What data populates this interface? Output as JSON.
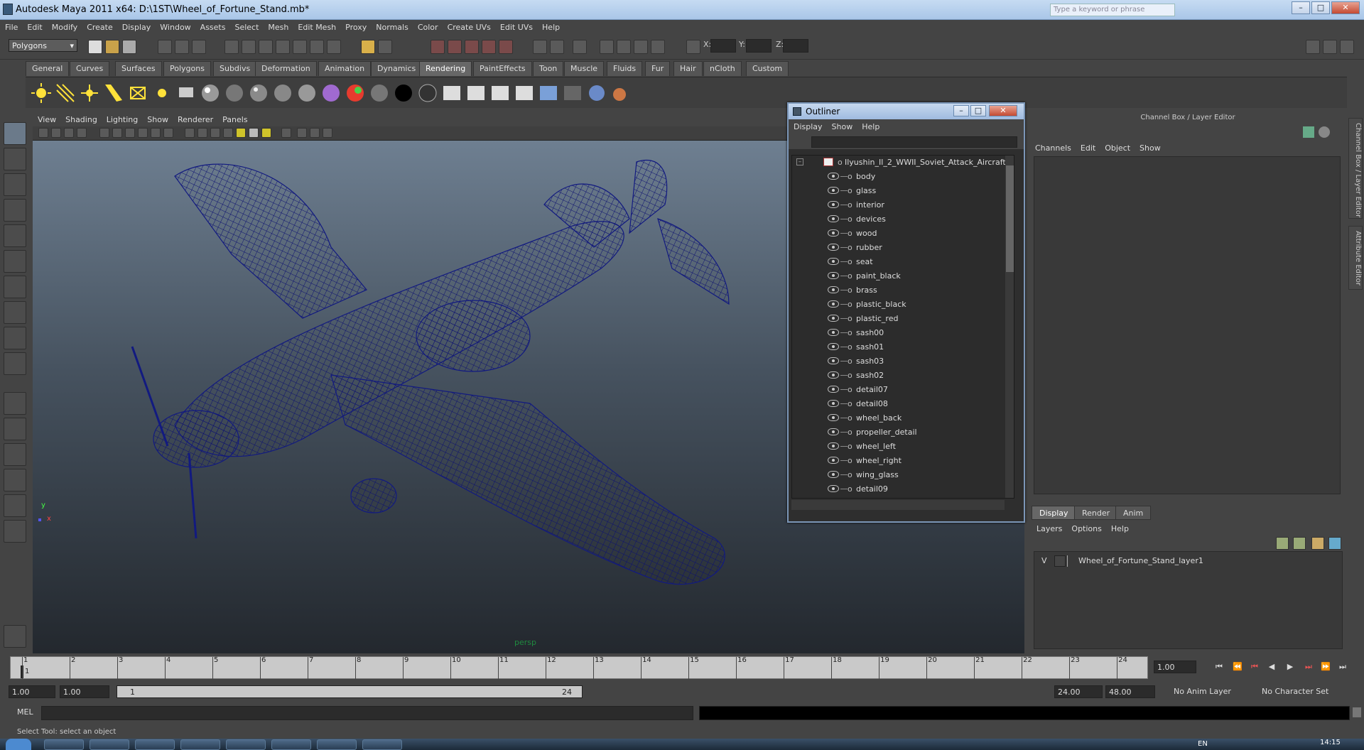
{
  "window": {
    "title": "Autodesk Maya 2011 x64: D:\\1ST\\Wheel_of_Fortune_Stand.mb*",
    "search_placeholder": "Type a keyword or phrase"
  },
  "menubar": [
    "File",
    "Edit",
    "Modify",
    "Create",
    "Display",
    "Window",
    "Assets",
    "Select",
    "Mesh",
    "Edit Mesh",
    "Proxy",
    "Normals",
    "Color",
    "Create UVs",
    "Edit UVs",
    "Help"
  ],
  "statusline": {
    "menu_set": "Polygons",
    "x_label": "X:",
    "y_label": "Y:",
    "z_label": "Z:"
  },
  "shelf_tabs": [
    "General",
    "Curves",
    "Surfaces",
    "Polygons",
    "Subdivs",
    "Deformation",
    "Animation",
    "Dynamics",
    "Rendering",
    "PaintEffects",
    "Toon",
    "Muscle",
    "Fluids",
    "Fur",
    "Hair",
    "nCloth",
    "Custom"
  ],
  "shelf_active": "Rendering",
  "viewport": {
    "menu": [
      "View",
      "Shading",
      "Lighting",
      "Show",
      "Renderer",
      "Panels"
    ],
    "camera_label": "persp",
    "axis_x": "x",
    "axis_y": "y"
  },
  "outliner": {
    "title": "Outliner",
    "menu": [
      "Display",
      "Show",
      "Help"
    ],
    "root": "Ilyushin_Il_2_WWII_Soviet_Attack_Aircraft",
    "children": [
      "body",
      "glass",
      "interior",
      "devices",
      "wood",
      "rubber",
      "seat",
      "paint_black",
      "brass",
      "plastic_black",
      "plastic_red",
      "sash00",
      "sash01",
      "sash03",
      "sash02",
      "detail07",
      "detail08",
      "wheel_back",
      "propeller_detail",
      "wheel_left",
      "wheel_right",
      "wing_glass",
      "detail09"
    ]
  },
  "channelbox": {
    "title": "Channel Box / Layer Editor",
    "menu": [
      "Channels",
      "Edit",
      "Object",
      "Show"
    ],
    "layer_tabs": [
      "Display",
      "Render",
      "Anim"
    ],
    "layer_tab_active": "Display",
    "layer_menu": [
      "Layers",
      "Options",
      "Help"
    ],
    "layer": {
      "visible": "V",
      "name": "Wheel_of_Fortune_Stand_layer1"
    },
    "side_tabs": [
      "Channel Box / Layer Editor",
      "Attribute Editor"
    ]
  },
  "timeline": {
    "ticks": [
      "1",
      "2",
      "3",
      "4",
      "5",
      "6",
      "7",
      "8",
      "9",
      "10",
      "11",
      "12",
      "13",
      "14",
      "15",
      "16",
      "17",
      "18",
      "19",
      "20",
      "21",
      "22",
      "23",
      "24"
    ],
    "current": "1",
    "current_frame_field": "1.00"
  },
  "range": {
    "start": "1.00",
    "start_inner": "1.00",
    "slider_start": "1",
    "slider_end": "24",
    "end_inner": "24.00",
    "end": "48.00",
    "anim_layer": "No Anim Layer",
    "char_set": "No Character Set"
  },
  "cmdline": {
    "label": "MEL"
  },
  "helpline": {
    "text": "Select Tool: select an object"
  },
  "taskbar": {
    "lang": "EN",
    "clock": "14:15"
  }
}
